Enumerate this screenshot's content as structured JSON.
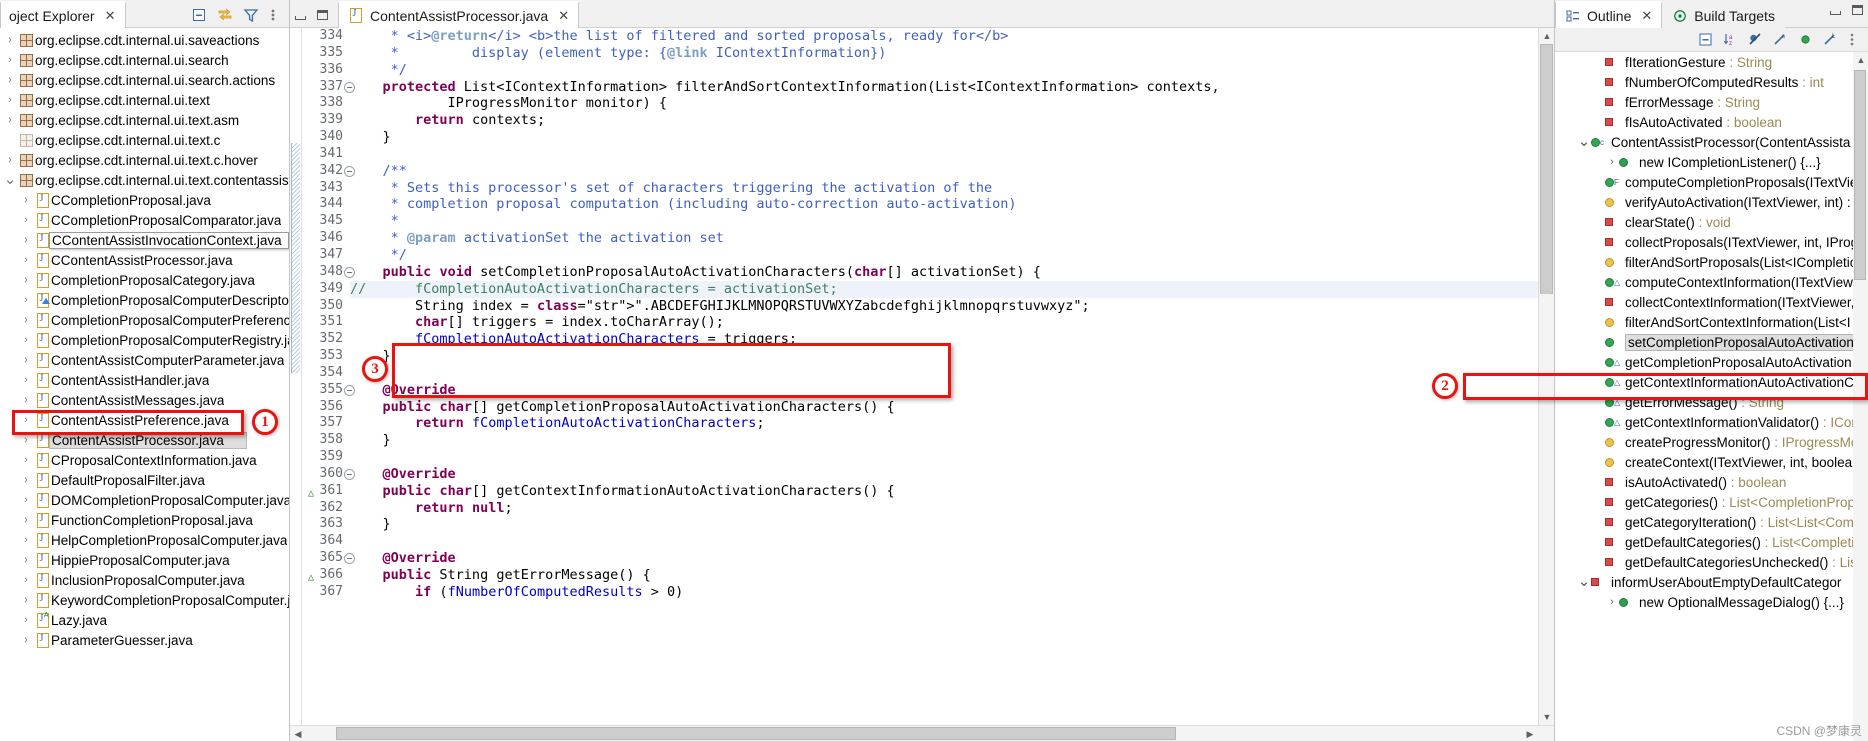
{
  "explorer": {
    "tab_label": "oject Explorer",
    "close_icon": "✕",
    "tools": [
      "collapse-all-icon",
      "link-with-editor-icon",
      "filter-icon",
      "view-menu-icon"
    ],
    "items": [
      {
        "label": "org.eclipse.cdt.internal.ui.saveactions",
        "type": "package",
        "arrow": ">",
        "level": 1
      },
      {
        "label": "org.eclipse.cdt.internal.ui.search",
        "type": "package",
        "arrow": ">",
        "level": 1
      },
      {
        "label": "org.eclipse.cdt.internal.ui.search.actions",
        "type": "package",
        "arrow": ">",
        "level": 1
      },
      {
        "label": "org.eclipse.cdt.internal.ui.text",
        "type": "package",
        "arrow": ">",
        "level": 1
      },
      {
        "label": "org.eclipse.cdt.internal.ui.text.asm",
        "type": "package",
        "arrow": ">",
        "level": 1
      },
      {
        "label": "org.eclipse.cdt.internal.ui.text.c",
        "type": "package-empty",
        "arrow": "",
        "level": 1
      },
      {
        "label": "org.eclipse.cdt.internal.ui.text.c.hover",
        "type": "package",
        "arrow": ">",
        "level": 1
      },
      {
        "label": "org.eclipse.cdt.internal.ui.text.contentassist",
        "type": "package",
        "arrow": "v",
        "level": 1
      },
      {
        "label": "CCompletionProposal.java",
        "type": "java",
        "arrow": ">",
        "level": 2
      },
      {
        "label": "CCompletionProposalComparator.java",
        "type": "java",
        "arrow": ">",
        "level": 2
      },
      {
        "label": "CContentAssistInvocationContext.java",
        "type": "java",
        "arrow": ">",
        "level": 2,
        "state": "hover"
      },
      {
        "label": "CContentAssistProcessor.java",
        "type": "java",
        "arrow": ">",
        "level": 2
      },
      {
        "label": "CompletionProposalCategory.java",
        "type": "java",
        "arrow": ">",
        "level": 2
      },
      {
        "label": "CompletionProposalComputerDescriptor.java",
        "type": "java-abstract",
        "arrow": ">",
        "level": 2
      },
      {
        "label": "CompletionProposalComputerPreference.java",
        "type": "java",
        "arrow": ">",
        "level": 2
      },
      {
        "label": "CompletionProposalComputerRegistry.java",
        "type": "java",
        "arrow": ">",
        "level": 2
      },
      {
        "label": "ContentAssistComputerParameter.java",
        "type": "java",
        "arrow": ">",
        "level": 2
      },
      {
        "label": "ContentAssistHandler.java",
        "type": "java",
        "arrow": ">",
        "level": 2
      },
      {
        "label": "ContentAssistMessages.java",
        "type": "java",
        "arrow": ">",
        "level": 2
      },
      {
        "label": "ContentAssistPreference.java",
        "type": "java",
        "arrow": ">",
        "level": 2
      },
      {
        "label": "ContentAssistProcessor.java",
        "type": "java",
        "arrow": ">",
        "level": 2,
        "state": "selected"
      },
      {
        "label": "CProposalContextInformation.java",
        "type": "java",
        "arrow": ">",
        "level": 2
      },
      {
        "label": "DefaultProposalFilter.java",
        "type": "java",
        "arrow": ">",
        "level": 2
      },
      {
        "label": "DOMCompletionProposalComputer.java",
        "type": "java",
        "arrow": ">",
        "level": 2
      },
      {
        "label": "FunctionCompletionProposal.java",
        "type": "java",
        "arrow": ">",
        "level": 2
      },
      {
        "label": "HelpCompletionProposalComputer.java",
        "type": "java",
        "arrow": ">",
        "level": 2
      },
      {
        "label": "HippieProposalComputer.java",
        "type": "java",
        "arrow": ">",
        "level": 2
      },
      {
        "label": "InclusionProposalComputer.java",
        "type": "java",
        "arrow": ">",
        "level": 2
      },
      {
        "label": "KeywordCompletionProposalComputer.java",
        "type": "java",
        "arrow": ">",
        "level": 2
      },
      {
        "label": "Lazy.java",
        "type": "java-annotation",
        "arrow": ">",
        "level": 2
      },
      {
        "label": "ParameterGuesser.java",
        "type": "java",
        "arrow": ">",
        "level": 2
      }
    ]
  },
  "editor": {
    "tab_label": "ContentAssistProcessor.java",
    "close_icon": "✕",
    "first_line_number": 334,
    "lines": [
      {
        "n": 334,
        "fold": false,
        "html": "     * <i>@return</i> <b>the list of filtered and sorted proposals, ready for</b>"
      },
      {
        "n": 335,
        "fold": false,
        "html": "     *         display (element type: {@link IContextInformation})"
      },
      {
        "n": 336,
        "fold": false,
        "html": "     */"
      },
      {
        "n": 337,
        "fold": true,
        "html": "    protected List<IContextInformation> filterAndSortContextInformation(List<IContextInformation> contexts,"
      },
      {
        "n": 338,
        "fold": false,
        "html": "            IProgressMonitor monitor) {"
      },
      {
        "n": 339,
        "fold": false,
        "html": "        return contexts;"
      },
      {
        "n": 340,
        "fold": false,
        "html": "    }"
      },
      {
        "n": 341,
        "fold": false,
        "html": ""
      },
      {
        "n": 342,
        "fold": true,
        "html": "    /**"
      },
      {
        "n": 343,
        "fold": false,
        "html": "     * Sets this processor's set of characters triggering the activation of the"
      },
      {
        "n": 344,
        "fold": false,
        "html": "     * completion proposal computation (including auto-correction auto-activation)"
      },
      {
        "n": 345,
        "fold": false,
        "html": "     *"
      },
      {
        "n": 346,
        "fold": false,
        "html": "     * @param activationSet the activation set"
      },
      {
        "n": 347,
        "fold": false,
        "html": "     */"
      },
      {
        "n": 348,
        "fold": true,
        "html": "    public void setCompletionProposalAutoActivationCharacters(char[] activationSet) {"
      },
      {
        "n": 349,
        "fold": false,
        "html": "//      fCompletionAutoActivationCharacters = activationSet;"
      },
      {
        "n": 350,
        "fold": false,
        "html": "        String index = \".ABCDEFGHIJKLMNOPQRSTUVWXYZabcdefghijklmnopqrstuvwxyz\";"
      },
      {
        "n": 351,
        "fold": false,
        "html": "        char[] triggers = index.toCharArray();"
      },
      {
        "n": 352,
        "fold": false,
        "html": "        fCompletionAutoActivationCharacters = triggers;"
      },
      {
        "n": 353,
        "fold": false,
        "html": "    }"
      },
      {
        "n": 354,
        "fold": false,
        "html": ""
      },
      {
        "n": 355,
        "fold": true,
        "html": "    @Override"
      },
      {
        "n": 356,
        "fold": false,
        "html": "    public char[] getCompletionProposalAutoActivationCharacters() {"
      },
      {
        "n": 357,
        "fold": false,
        "html": "        return fCompletionAutoActivationCharacters;"
      },
      {
        "n": 358,
        "fold": false,
        "html": "    }"
      },
      {
        "n": 359,
        "fold": false,
        "html": ""
      },
      {
        "n": 360,
        "fold": true,
        "html": "    @Override"
      },
      {
        "n": 361,
        "fold": false,
        "html": "    public char[] getContextInformationAutoActivationCharacters() {"
      },
      {
        "n": 362,
        "fold": false,
        "html": "        return null;"
      },
      {
        "n": 363,
        "fold": false,
        "html": "    }"
      },
      {
        "n": 364,
        "fold": false,
        "html": ""
      },
      {
        "n": 365,
        "fold": true,
        "html": "    @Override"
      },
      {
        "n": 366,
        "fold": false,
        "html": "    public String getErrorMessage() {"
      },
      {
        "n": 367,
        "fold": false,
        "html": "        if (fNumberOfComputedResults > 0)"
      }
    ]
  },
  "outline": {
    "tabs": [
      {
        "label": "Outline",
        "active": true,
        "icon": "outline-icon",
        "close_icon": "✕"
      },
      {
        "label": "Build Targets",
        "active": false,
        "icon": "build-targets-icon"
      }
    ],
    "tools": [
      "collapse-all-icon",
      "sort-icon",
      "hide-fields-icon",
      "hide-static-icon",
      "hide-nonpublic-icon",
      "hide-local-icon",
      "view-menu-icon"
    ],
    "items": [
      {
        "label": "fIterationGesture",
        "type": " : String",
        "icon": "field-red",
        "indent": 2,
        "twisty": ""
      },
      {
        "label": "fNumberOfComputedResults",
        "type": " : int",
        "icon": "field-red",
        "indent": 2,
        "twisty": ""
      },
      {
        "label": "fErrorMessage",
        "type": " : String",
        "icon": "field-red",
        "indent": 2,
        "twisty": ""
      },
      {
        "label": "fIsAutoActivated",
        "type": " : boolean",
        "icon": "field-red",
        "indent": 2,
        "twisty": ""
      },
      {
        "label": "ContentAssistProcessor(ContentAssista",
        "type": "",
        "icon": "ctor-green-c",
        "indent": 1,
        "twisty": "v"
      },
      {
        "label": "new ICompletionListener() {...}",
        "type": "",
        "icon": "anon-class",
        "indent": 3,
        "twisty": ">"
      },
      {
        "label": "computeCompletionProposals(ITextVie",
        "type": "",
        "icon": "method-green-f",
        "indent": 2,
        "twisty": ""
      },
      {
        "label": "verifyAutoActivation(ITextViewer, int) :",
        "type": "",
        "icon": "method-yellow",
        "indent": 2,
        "twisty": ""
      },
      {
        "label": "clearState()",
        "type": " : void",
        "icon": "field-red",
        "indent": 2,
        "twisty": ""
      },
      {
        "label": "collectProposals(ITextViewer, int, IProg",
        "type": "",
        "icon": "field-red",
        "indent": 2,
        "twisty": ""
      },
      {
        "label": "filterAndSortProposals(List<ICompletio",
        "type": "",
        "icon": "method-yellow",
        "indent": 2,
        "twisty": ""
      },
      {
        "label": "computeContextInformation(ITextView",
        "type": "",
        "icon": "method-green-a",
        "indent": 2,
        "twisty": ""
      },
      {
        "label": "collectContextInformation(ITextViewer,",
        "type": "",
        "icon": "field-red",
        "indent": 2,
        "twisty": ""
      },
      {
        "label": "filterAndSortContextInformation(List<I",
        "type": "",
        "icon": "method-yellow",
        "indent": 2,
        "twisty": ""
      },
      {
        "label": "setCompletionProposalAutoActivation",
        "type": "",
        "icon": "method-green",
        "indent": 2,
        "twisty": "",
        "state": "selected"
      },
      {
        "label": "getCompletionProposalAutoActivation",
        "type": "",
        "icon": "method-green-a",
        "indent": 2,
        "twisty": ""
      },
      {
        "label": "getContextInformationAutoActivationC",
        "type": "",
        "icon": "method-green-a",
        "indent": 2,
        "twisty": ""
      },
      {
        "label": "getErrorMessage()",
        "type": " : String",
        "icon": "method-green-a",
        "indent": 2,
        "twisty": ""
      },
      {
        "label": "getContextInformationValidator()",
        "type": " : ICor",
        "icon": "method-green-a",
        "indent": 2,
        "twisty": ""
      },
      {
        "label": "createProgressMonitor()",
        "type": " : IProgressMo",
        "icon": "method-yellow",
        "indent": 2,
        "twisty": ""
      },
      {
        "label": "createContext(ITextViewer, int, boolear",
        "type": "",
        "icon": "method-yellow",
        "indent": 2,
        "twisty": ""
      },
      {
        "label": "isAutoActivated()",
        "type": " : boolean",
        "icon": "field-red",
        "indent": 2,
        "twisty": ""
      },
      {
        "label": "getCategories()",
        "type": " : List<CompletionProp",
        "icon": "field-red",
        "indent": 2,
        "twisty": ""
      },
      {
        "label": "getCategoryIteration()",
        "type": " : List<List<Comp",
        "icon": "field-red",
        "indent": 2,
        "twisty": ""
      },
      {
        "label": "getDefaultCategories()",
        "type": " : List<Completio",
        "icon": "field-red",
        "indent": 2,
        "twisty": ""
      },
      {
        "label": "getDefaultCategoriesUnchecked()",
        "type": " : List",
        "icon": "field-red",
        "indent": 2,
        "twisty": ""
      },
      {
        "label": "informUserAboutEmptyDefaultCategor",
        "type": "",
        "icon": "field-red",
        "indent": 1,
        "twisty": "v"
      },
      {
        "label": "new OptionalMessageDialog() {...}",
        "type": "",
        "icon": "anon-class",
        "indent": 3,
        "twisty": ">"
      }
    ]
  },
  "annotations": {
    "marker1": "1",
    "marker2": "2",
    "marker3": "3"
  },
  "watermark": "CSDN @梦康灵"
}
